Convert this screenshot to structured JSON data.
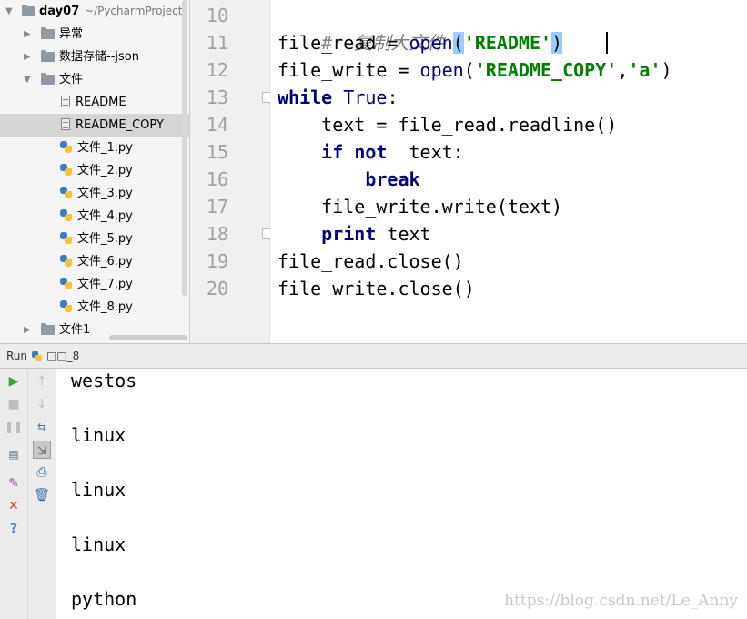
{
  "tree": {
    "project_name": "day07",
    "project_path": "~/PycharmProject",
    "items": [
      {
        "label": "异常",
        "type": "folder"
      },
      {
        "label": "数据存储--json",
        "type": "folder"
      },
      {
        "label": "文件",
        "type": "folder"
      },
      {
        "label": "README",
        "type": "text"
      },
      {
        "label": "README_COPY",
        "type": "text",
        "selected": true
      },
      {
        "label": "文件_1.py",
        "type": "py"
      },
      {
        "label": "文件_2.py",
        "type": "py"
      },
      {
        "label": "文件_3.py",
        "type": "py"
      },
      {
        "label": "文件_4.py",
        "type": "py"
      },
      {
        "label": "文件_5.py",
        "type": "py"
      },
      {
        "label": "文件_6.py",
        "type": "py"
      },
      {
        "label": "文件_7.py",
        "type": "py"
      },
      {
        "label": "文件_8.py",
        "type": "py"
      },
      {
        "label": "文件1",
        "type": "folder"
      }
    ]
  },
  "editor": {
    "line_numbers": [
      "10",
      "11",
      "12",
      "13",
      "14",
      "15",
      "16",
      "17",
      "18",
      "19",
      "20"
    ],
    "lines": {
      "l10": "#  复制大文件",
      "l11_a": "file_read = ",
      "l11_b": "open",
      "l11_c": "(",
      "l11_d": "'README'",
      "l11_e": ")",
      "l12_a": "file_write = ",
      "l12_b": "open",
      "l12_c": "(",
      "l12_d": "'README_COPY'",
      "l12_e": ",",
      "l12_f": "'a'",
      "l12_g": ")",
      "l13_a": "while",
      "l13_b": " True",
      "l13_c": ":",
      "l14": "    text = file_read.readline()",
      "l15_a": "    ",
      "l15_b": "if",
      "l15_c": " ",
      "l15_d": "not",
      "l15_e": "  text:",
      "l16_a": "        ",
      "l16_b": "break",
      "l17": "    file_write.write(text)",
      "l18_a": "    ",
      "l18_b": "print",
      "l18_c": " text",
      "l19": "file_read.close()",
      "l20": "file_write.close()"
    }
  },
  "run": {
    "label": "Run",
    "config_name": "□□_8"
  },
  "console": {
    "output": [
      "westos",
      "linux",
      "linux",
      "linux",
      "python"
    ]
  },
  "watermark": "https://blog.csdn.net/Le_Anny",
  "colors": {
    "keyword": "#000080",
    "string": "#008000",
    "comment": "#808080",
    "current_line": "#fffae3",
    "brace_match": "#99ccff"
  }
}
